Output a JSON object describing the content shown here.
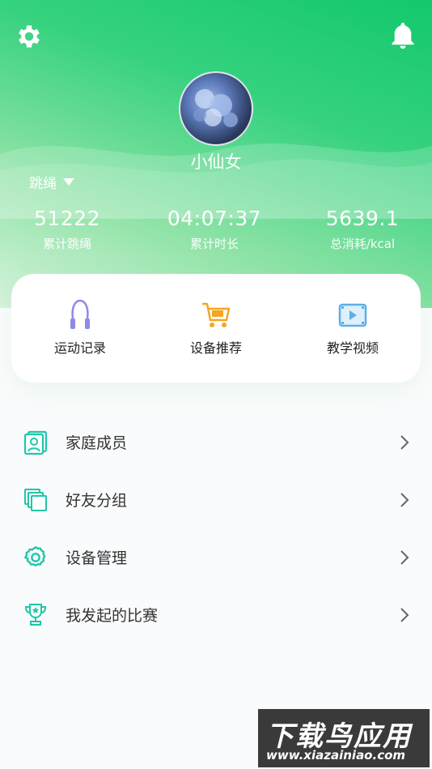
{
  "profile": {
    "name": "小仙女",
    "mode": "跳绳"
  },
  "stats": [
    {
      "value": "51222",
      "label": "累计跳绳"
    },
    {
      "value": "04:07:37",
      "label": "累计时长"
    },
    {
      "value": "5639.1",
      "label": "总消耗/kcal"
    }
  ],
  "shortcuts": [
    {
      "label": "运动记录",
      "icon": "jump-rope-icon"
    },
    {
      "label": "设备推荐",
      "icon": "shopping-cart-icon"
    },
    {
      "label": "教学视频",
      "icon": "video-icon"
    }
  ],
  "menu": [
    {
      "label": "家庭成员",
      "icon": "family-members-icon"
    },
    {
      "label": "好友分组",
      "icon": "friend-groups-icon"
    },
    {
      "label": "设备管理",
      "icon": "gear-icon"
    },
    {
      "label": "我发起的比赛",
      "icon": "trophy-icon"
    }
  ],
  "watermark": {
    "title": "下载鸟应用",
    "url": "www.xiazainiao.com"
  },
  "colors": {
    "header_green": "#13c86d",
    "accent_teal": "#1fc7a8",
    "cart_orange": "#f5a623",
    "rope_purple": "#8e8ae6",
    "video_blue": "#5ab0e8"
  }
}
